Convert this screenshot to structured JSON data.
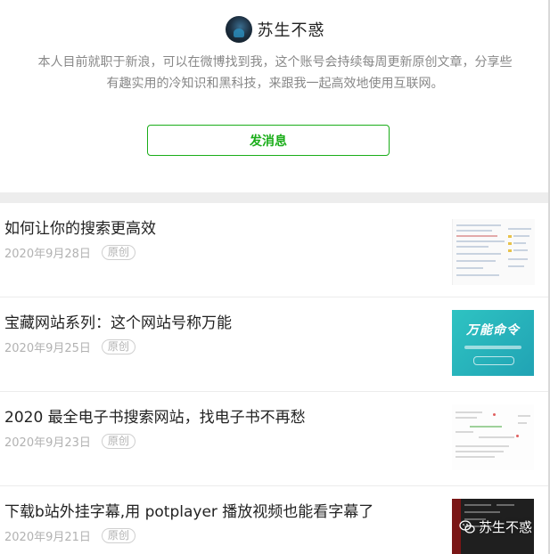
{
  "profile": {
    "name": "苏生不惑",
    "bio_line1": "本人目前就职于新浪，可以在微博找到我，这个账号会持续每周更新原创文章，分享些",
    "bio_line2": "有趣实用的冷知识和黑科技，来跟我一起高效地使用互联网。",
    "send_button": "发消息"
  },
  "articles": [
    {
      "title": "如何让你的搜索更高效",
      "date": "2020年9月28日",
      "tag": "原创",
      "thumb": "screenshot"
    },
    {
      "title": "宝藏网站系列：这个网站号称万能",
      "date": "2020年9月25日",
      "tag": "原创",
      "thumb": "banner",
      "thumb_text": "万能命令"
    },
    {
      "title": "2020 最全电子书搜索网站，找电子书不再愁",
      "date": "2020年9月23日",
      "tag": "原创",
      "thumb": "screenshot"
    },
    {
      "title": "下载b站外挂字幕,用 potplayer 播放视频也能看字幕了",
      "date": "2020年9月21日",
      "tag": "原创",
      "thumb": "player"
    }
  ],
  "watermark": {
    "icon": "wechat-icon",
    "text": "苏生不惑"
  },
  "colors": {
    "accent": "#1aad19",
    "muted_text": "#b2b2b2",
    "bio_text": "#888888",
    "band": "#ededed"
  }
}
